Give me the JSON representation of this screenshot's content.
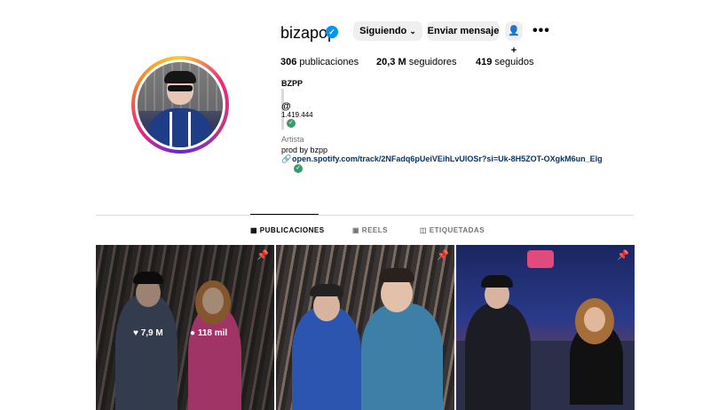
{
  "profile": {
    "username": "bizapop",
    "following_button": "Siguiendo",
    "message_button": "Enviar mensaje",
    "stats": {
      "posts_count": "306",
      "posts_label": "publicaciones",
      "followers_count": "20,3 M",
      "followers_label": "seguidores",
      "following_count": "419",
      "following_label": "seguidos"
    },
    "bio": {
      "name": "BZPP",
      "threads_count": "1.419.444",
      "category": "Artista",
      "text": "prod by bzpp",
      "link": "open.spotify.com/track/2NFadq6pUeiVEihLvUlOSr?si=Uk-8H5ZOT-OXgkM6un_Elg"
    }
  },
  "tabs": [
    {
      "label": "PUBLICACIONES",
      "icon": "grid-icon",
      "active": true
    },
    {
      "label": "REELS",
      "icon": "reels-icon",
      "active": false
    },
    {
      "label": "ETIQUETADAS",
      "icon": "tagged-icon",
      "active": false
    }
  ],
  "posts": [
    {
      "likes": "7,9 M",
      "comments": "118 mil",
      "pinned": true
    },
    {
      "pinned": true
    },
    {
      "pinned": true
    }
  ],
  "colors": {
    "verified": "#0095f6",
    "link": "#00376b",
    "button_bg": "#efefef"
  }
}
